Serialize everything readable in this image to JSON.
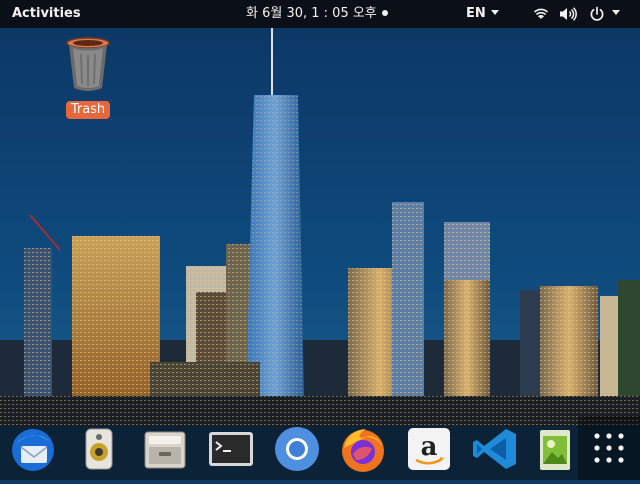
{
  "topbar": {
    "activities": "Activities",
    "clock": "화  6월 30,  1 : 05 오후",
    "language": "EN",
    "icons": [
      "wifi-icon",
      "volume-icon",
      "power-icon"
    ]
  },
  "desktop": {
    "trash_label": "Trash",
    "trash_icon": "trash-icon"
  },
  "dock": {
    "apps": [
      {
        "name": "thunderbird-mail",
        "icon": "mail-icon"
      },
      {
        "name": "rhythmbox-music",
        "icon": "speaker-icon"
      },
      {
        "name": "files",
        "icon": "file-cabinet-icon"
      },
      {
        "name": "terminal",
        "icon": "terminal-icon"
      },
      {
        "name": "chromium",
        "icon": "browser-icon"
      },
      {
        "name": "firefox",
        "icon": "firefox-icon"
      },
      {
        "name": "amazon",
        "icon": "amazon-icon"
      },
      {
        "name": "visual-studio-code",
        "icon": "vscode-icon"
      },
      {
        "name": "image-viewer",
        "icon": "image-viewer-icon"
      },
      {
        "name": "show-applications",
        "icon": "app-grid-icon"
      }
    ]
  },
  "colors": {
    "topbar": "#0b1016",
    "accent_orange": "#e4683b",
    "sky": "#0e3a63"
  }
}
